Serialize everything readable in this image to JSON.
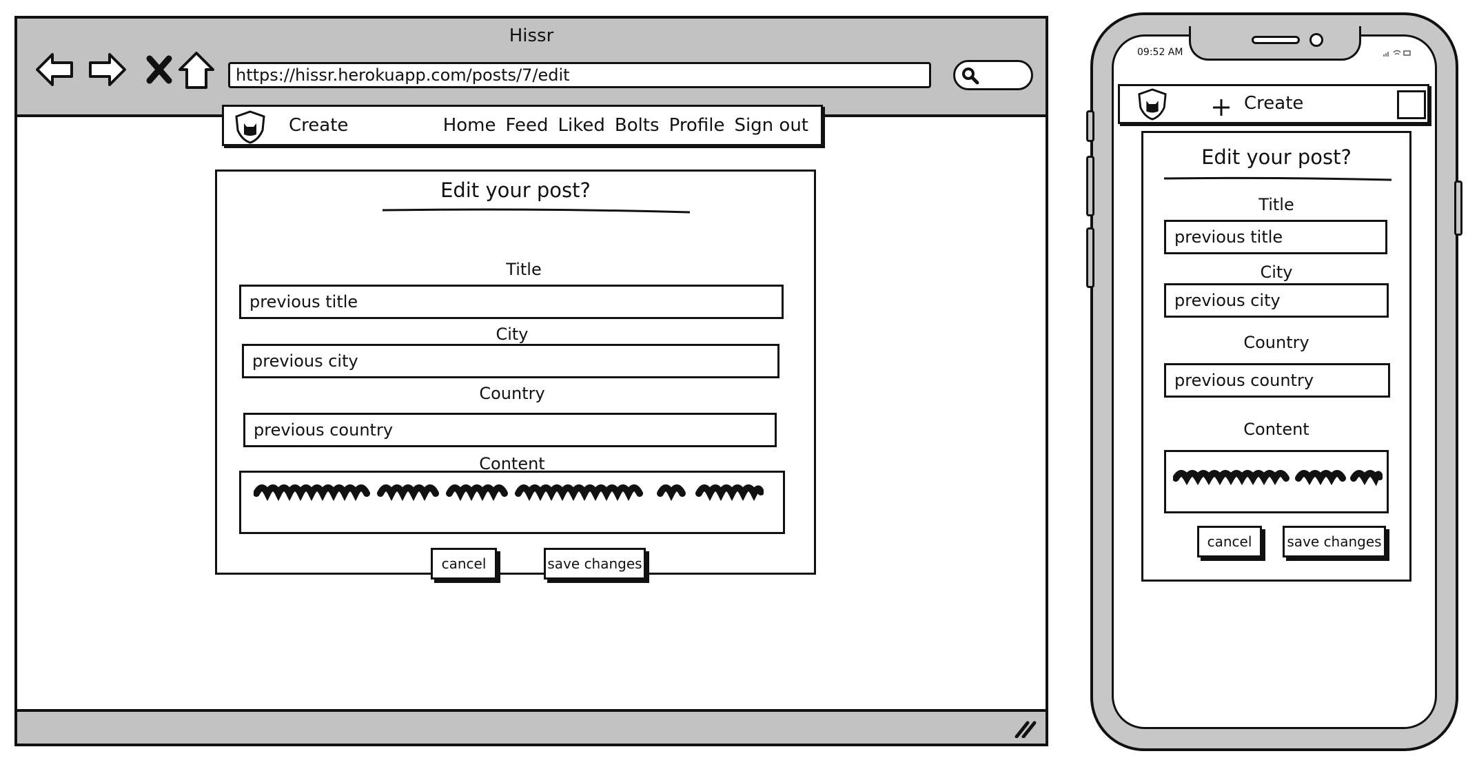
{
  "browser": {
    "window_title": "Hissr",
    "url": "https://hissr.herokuapp.com/posts/7/edit",
    "nav_icons": [
      "back-arrow-icon",
      "forward-arrow-icon",
      "stop-x-icon",
      "home-icon"
    ]
  },
  "site": {
    "create_label": "Create",
    "links": [
      "Home",
      "Feed",
      "Liked",
      "Bolts",
      "Profile",
      "Sign out"
    ]
  },
  "form": {
    "heading": "Edit your post?",
    "title_label": "Title",
    "title_value": "previous title",
    "city_label": "City",
    "city_value": "previous city",
    "country_label": "Country",
    "country_value": "previous country",
    "content_label": "Content",
    "cancel_label": "cancel",
    "save_label": "save changes"
  },
  "phone": {
    "time": "09:52 AM",
    "create_label": "Create"
  }
}
